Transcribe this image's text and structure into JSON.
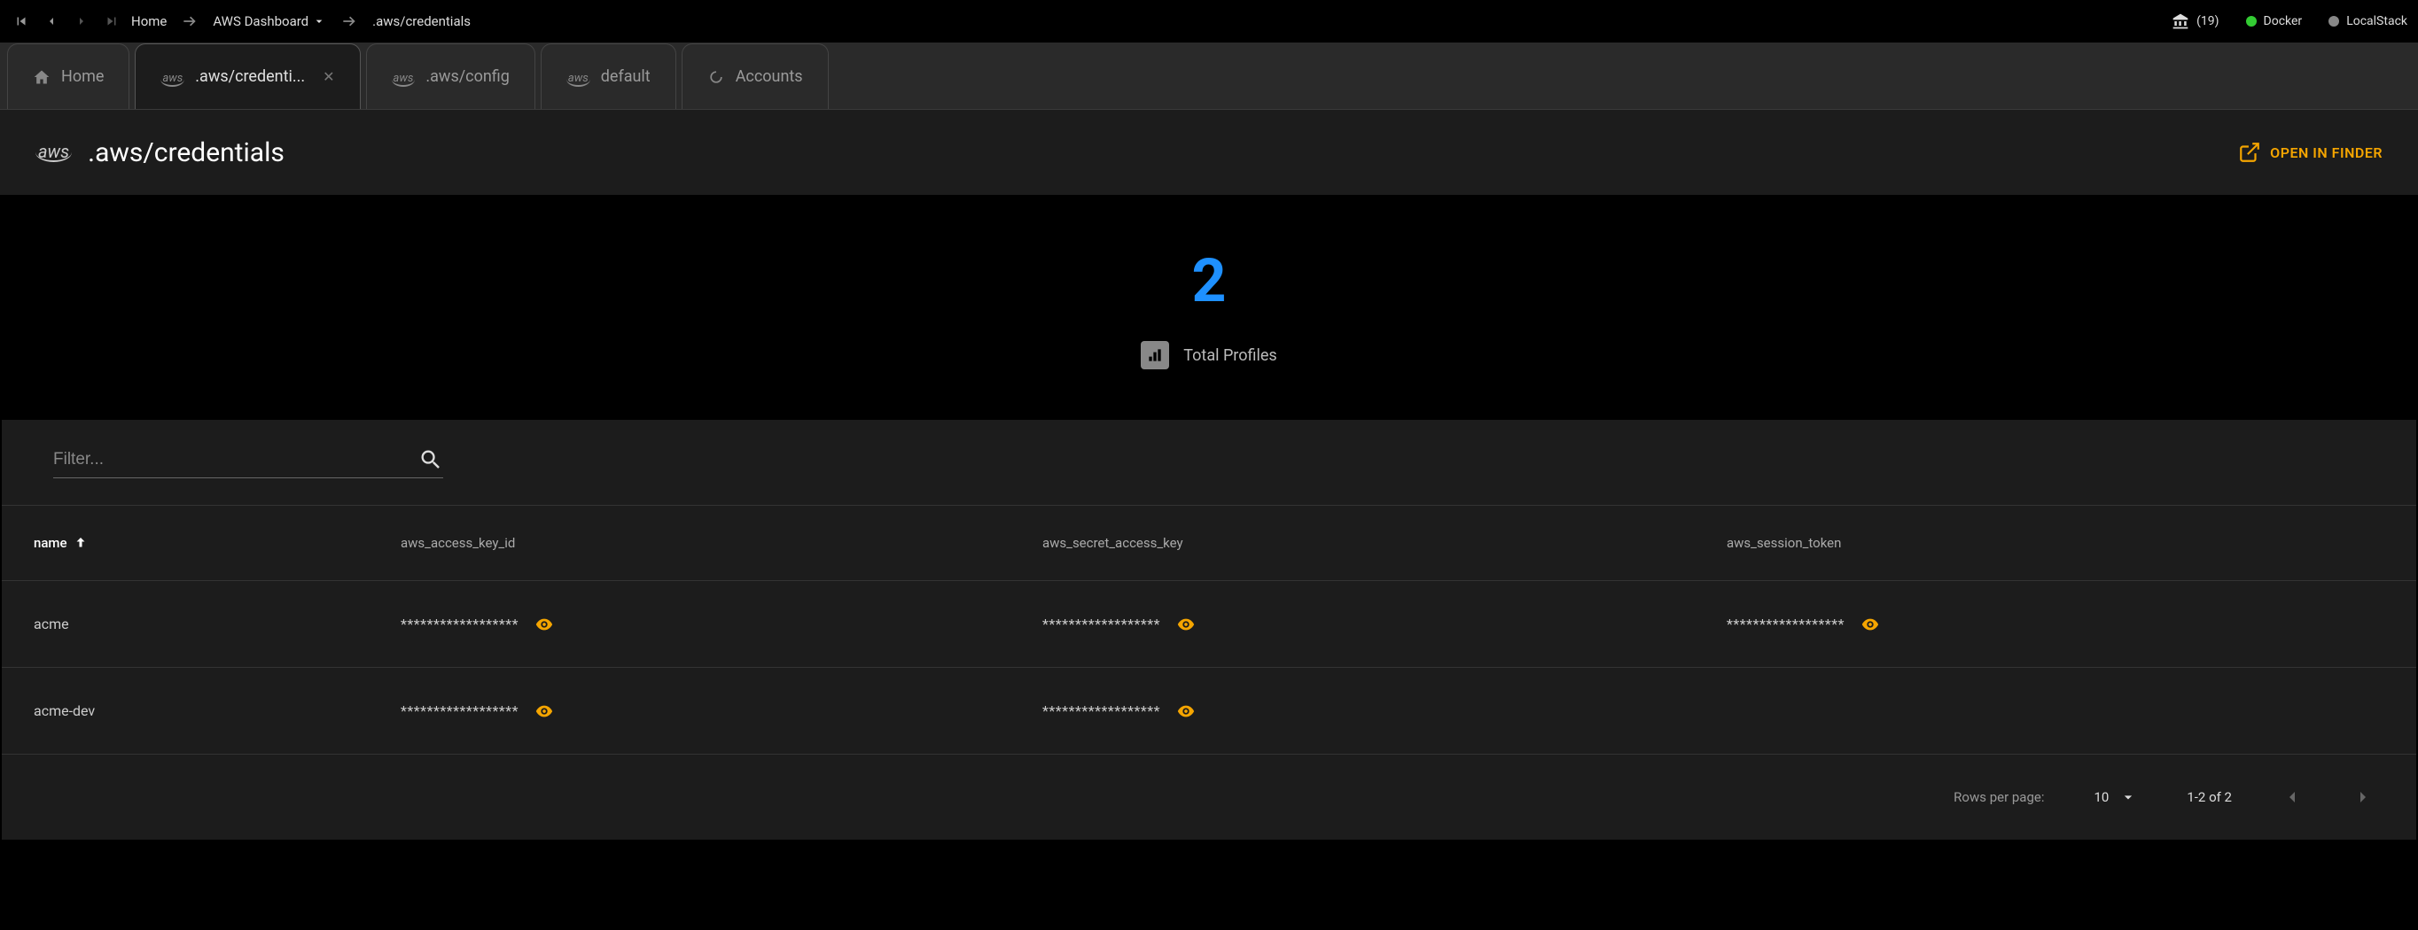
{
  "topbar": {
    "home": "Home",
    "dashboard": "AWS Dashboard",
    "current": ".aws/credentials",
    "bank_count": "(19)",
    "docker": "Docker",
    "localstack": "LocalStack"
  },
  "tabs": [
    {
      "label": "Home",
      "name": "tab-home"
    },
    {
      "label": ".aws/credenti...",
      "name": "tab-credentials",
      "active": true,
      "closable": true
    },
    {
      "label": ".aws/config",
      "name": "tab-config"
    },
    {
      "label": "default",
      "name": "tab-default"
    },
    {
      "label": "Accounts",
      "name": "tab-accounts"
    }
  ],
  "header": {
    "title": ".aws/credentials",
    "open_finder": "OPEN IN FINDER"
  },
  "stats": {
    "number": "2",
    "label": "Total Profiles"
  },
  "filter": {
    "placeholder": "Filter..."
  },
  "table": {
    "columns": {
      "name": "name",
      "access_key": "aws_access_key_id",
      "secret_key": "aws_secret_access_key",
      "session_token": "aws_session_token"
    },
    "rows": [
      {
        "name": "acme",
        "access_key": "******************",
        "secret_key": "******************",
        "session_token": "******************",
        "has_token": true
      },
      {
        "name": "acme-dev",
        "access_key": "******************",
        "secret_key": "******************",
        "session_token": "",
        "has_token": false
      }
    ]
  },
  "pagination": {
    "rpp_label": "Rows per page:",
    "rpp_value": "10",
    "range": "1-2 of 2"
  }
}
